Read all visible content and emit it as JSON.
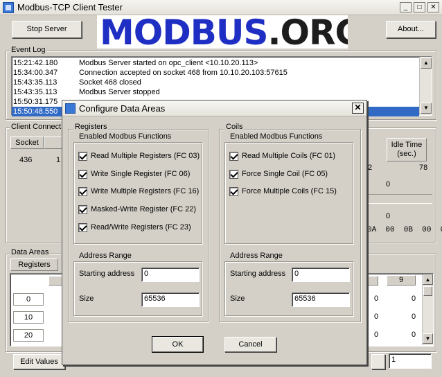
{
  "window": {
    "title": "Modbus-TCP Client Tester",
    "controls": [
      "_",
      "□",
      "✕"
    ]
  },
  "toolbar": {
    "stop_server": "Stop Server",
    "about": "About...",
    "logo": {
      "part1": "MODBUS",
      "part2": ".ORG"
    }
  },
  "event_log": {
    "label": "Event Log",
    "rows": [
      {
        "time": "15:21:42.180",
        "message": "Modbus Server started on opc_client <10.10.20.113>"
      },
      {
        "time": "15:34:00.347",
        "message": "Connection accepted on socket 468 from 10.10.20.103:57615"
      },
      {
        "time": "15:43:35.113",
        "message": "Socket 468 closed"
      },
      {
        "time": "15:43:35.113",
        "message": "Modbus Server stopped"
      },
      {
        "time": "15:50:31.175",
        "message": ""
      },
      {
        "time": "15:50:48.550",
        "message": ""
      }
    ]
  },
  "client_connections": {
    "label": "Client Connect",
    "col_socket": "Socket",
    "socket_value": "436",
    "socket_partial": "1",
    "idle_header": "Idle Time\n(sec.)",
    "value_2": "2",
    "value_78": "78",
    "value_0a": "0",
    "value_0b": "0",
    "hex_line": "0A  00  0B  00  0"
  },
  "data_areas": {
    "label": "Data Areas",
    "tab_registers": "Registers",
    "col_9": "9",
    "row_addresses": [
      "0",
      "10",
      "20"
    ],
    "right_values_col1": [
      "0",
      "0",
      "0"
    ],
    "right_values_col2": [
      "0",
      "0",
      "0"
    ],
    "edit_values": "Edit Values",
    "page_input": "1"
  },
  "dialog": {
    "title": "Configure Data Areas",
    "close": "✕",
    "registers": {
      "label": "Registers",
      "functions_label": "Enabled Modbus Functions",
      "functions": [
        "Read Multiple Registers (FC 03)",
        "Write Single Register (FC 06)",
        "Write Multiple Registers (FC 16)",
        "Masked-Write Register (FC 22)",
        "Read/Write Registers (FC 23)"
      ],
      "address_label": "Address Range",
      "start_label": "Starting address",
      "start_value": "0",
      "size_label": "Size",
      "size_value": "65536"
    },
    "coils": {
      "label": "Coils",
      "functions_label": "Enabled Modbus Functions",
      "functions": [
        "Read Multiple Coils (FC 01)",
        "Force Single Coil (FC 05)",
        "Force Multiple Coils (FC 15)"
      ],
      "address_label": "Address Range",
      "start_label": "Starting address",
      "start_value": "0",
      "size_label": "Size",
      "size_value": "65536"
    },
    "ok": "OK",
    "cancel": "Cancel"
  }
}
